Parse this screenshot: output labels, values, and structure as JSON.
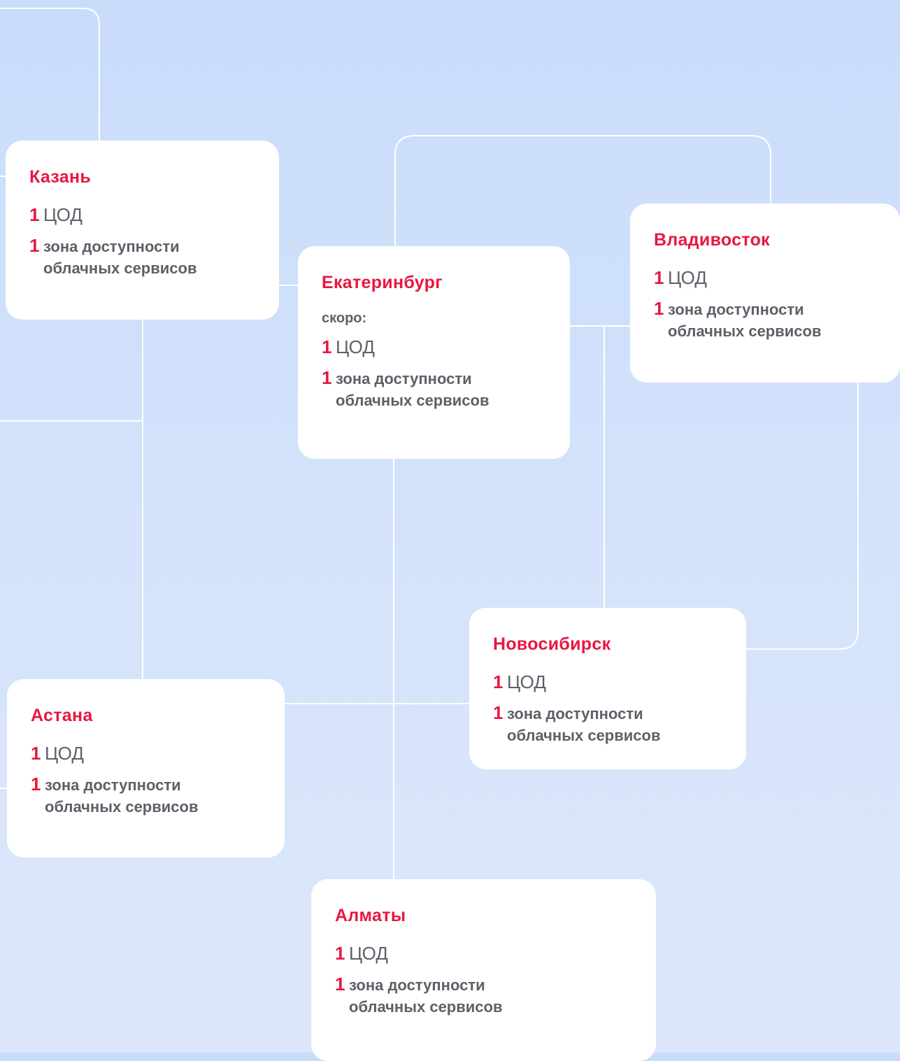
{
  "colors": {
    "accent": "#e8173f",
    "text": "#5d6068",
    "card": "#ffffff",
    "connector": "#ffffff",
    "background": "#cfe0fb"
  },
  "cards": {
    "kazan": {
      "city": "Казань",
      "dc_count": "1",
      "dc_label": "ЦОД",
      "zone_count": "1",
      "zone_label_line1": "зона доступности",
      "zone_label_line2": "облачных сервисов"
    },
    "ekaterinburg": {
      "city": "Екатеринбург",
      "status": "скоро:",
      "dc_count": "1",
      "dc_label": "ЦОД",
      "zone_count": "1",
      "zone_label_line1": "зона доступности",
      "zone_label_line2": "облачных сервисов"
    },
    "vladivostok": {
      "city": "Владивосток",
      "dc_count": "1",
      "dc_label": "ЦОД",
      "zone_count": "1",
      "zone_label_line1": "зона доступности",
      "zone_label_line2": "облачных сервисов"
    },
    "novosibirsk": {
      "city": "Новосибирск",
      "dc_count": "1",
      "dc_label": "ЦОД",
      "zone_count": "1",
      "zone_label_line1": "зона доступности",
      "zone_label_line2": "облачных сервисов"
    },
    "astana": {
      "city": "Астана",
      "dc_count": "1",
      "dc_label": "ЦОД",
      "zone_count": "1",
      "zone_label_line1": "зона доступности",
      "zone_label_line2": "облачных сервисов"
    },
    "almaty": {
      "city": "Алматы",
      "dc_count": "1",
      "dc_label": "ЦОД",
      "zone_count": "1",
      "zone_label_line1": "зона доступности",
      "zone_label_line2": "облачных сервисов"
    }
  }
}
